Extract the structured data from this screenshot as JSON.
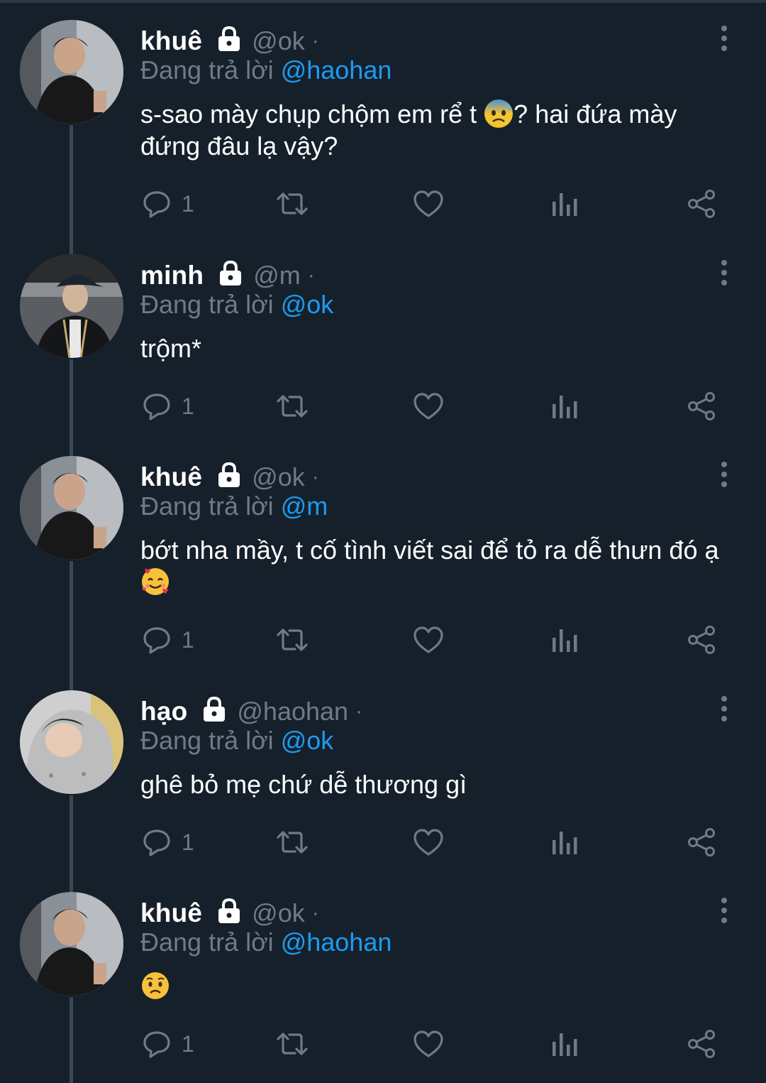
{
  "colors": {
    "background": "#15202b",
    "muted": "#6e7b87",
    "accent": "#1d9bf0",
    "thread_line": "#3a4754"
  },
  "reply_prefix": "Đang trả lời ",
  "separator": "·",
  "tweets": [
    {
      "display_name": "khuê",
      "handle": "@ok",
      "reply_to": "@haohan",
      "text_parts": [
        "s-sao mày chụp chộm em rể t ",
        "? hai đứa mày đứng đâu lạ vậy?"
      ],
      "emoji": "anxious-face-with-sweat",
      "reply_count": "1",
      "icons": [
        "lock-icon",
        "reply-icon",
        "retweet-icon",
        "like-icon",
        "analytics-icon",
        "share-icon",
        "more-icon"
      ]
    },
    {
      "display_name": "minh",
      "handle": "@m",
      "reply_to": "@ok",
      "text_parts": [
        "trộm*"
      ],
      "emoji": "",
      "reply_count": "1"
    },
    {
      "display_name": "khuê",
      "handle": "@ok",
      "reply_to": "@m",
      "text_parts": [
        "bớt nha mầy, t cố tình viết sai để tỏ ra dễ thưn đó ạ "
      ],
      "emoji": "smiling-face-with-hearts",
      "reply_count": "1"
    },
    {
      "display_name": "hạo",
      "handle": "@haohan",
      "reply_to": "@ok",
      "text_parts": [
        "ghê bỏ mẹ chứ dễ thương gì"
      ],
      "emoji": "",
      "reply_count": "1"
    },
    {
      "display_name": "khuê",
      "handle": "@ok",
      "reply_to": "@haohan",
      "text_parts": [
        ""
      ],
      "emoji": "worried-face",
      "reply_count": "1"
    }
  ]
}
